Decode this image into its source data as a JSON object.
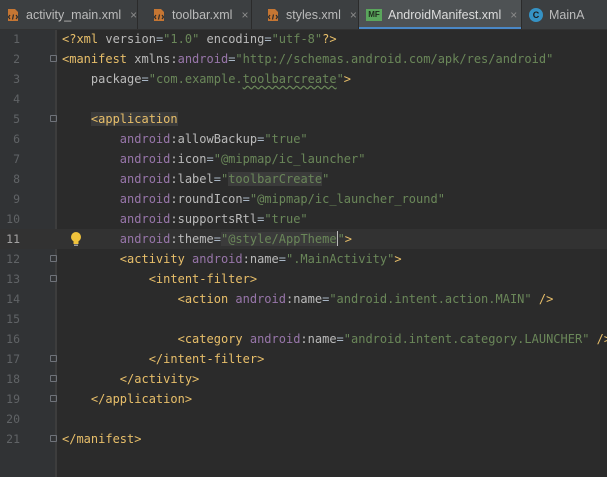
{
  "tabs": [
    {
      "label": "activity_main.xml",
      "icon": "xml-file-icon",
      "active": false
    },
    {
      "label": "toolbar.xml",
      "icon": "xml-file-icon",
      "active": false
    },
    {
      "label": "styles.xml",
      "icon": "xml-file-icon",
      "active": false
    },
    {
      "label": "AndroidManifest.xml",
      "icon": "manifest-file-icon",
      "icon_text": "MF",
      "active": true
    },
    {
      "label": "MainA",
      "icon": "class-file-icon",
      "icon_text": "C",
      "active": false
    }
  ],
  "close_glyph": "×",
  "current_line": 11,
  "colors": {
    "editor_bg": "#2b2b2b",
    "tag": "#e8bf6a",
    "attribute": "#bababa",
    "namespace": "#9876aa",
    "value": "#6a8759",
    "text": "#a9b7c6",
    "active_tab_underline": "#4a88c7"
  },
  "lines": [
    {
      "n": "1",
      "tokens": [
        [
          "pi",
          "<?xml "
        ],
        [
          "attr",
          "version"
        ],
        [
          "plain",
          "="
        ],
        [
          "val",
          "\"1.0\""
        ],
        [
          "plain",
          " "
        ],
        [
          "attr",
          "encoding"
        ],
        [
          "plain",
          "="
        ],
        [
          "val",
          "\"utf-8\""
        ],
        [
          "pi",
          "?>"
        ]
      ]
    },
    {
      "n": "2",
      "tokens": [
        [
          "tag",
          "<manifest "
        ],
        [
          "attr",
          "xmlns:"
        ],
        [
          "ns",
          "android"
        ],
        [
          "plain",
          "="
        ],
        [
          "val",
          "\"http://schemas.android.com/apk/res/android\""
        ]
      ]
    },
    {
      "n": "3",
      "tokens": [
        [
          "plain",
          "    "
        ],
        [
          "attr",
          "package"
        ],
        [
          "plain",
          "="
        ],
        [
          "val",
          "\"com.example."
        ],
        [
          "valsq",
          "toolbarcreate"
        ],
        [
          "val",
          "\""
        ],
        [
          "tag",
          ">"
        ]
      ]
    },
    {
      "n": "4",
      "tokens": []
    },
    {
      "n": "5",
      "tokens": [
        [
          "plain",
          "    "
        ],
        [
          "taghl",
          "<application"
        ]
      ]
    },
    {
      "n": "6",
      "tokens": [
        [
          "plain",
          "        "
        ],
        [
          "ns",
          "android"
        ],
        [
          "attr",
          ":allowBackup"
        ],
        [
          "plain",
          "="
        ],
        [
          "val",
          "\"true\""
        ]
      ]
    },
    {
      "n": "7",
      "tokens": [
        [
          "plain",
          "        "
        ],
        [
          "ns",
          "android"
        ],
        [
          "attr",
          ":icon"
        ],
        [
          "plain",
          "="
        ],
        [
          "val",
          "\"@mipmap/ic_launcher\""
        ]
      ]
    },
    {
      "n": "8",
      "tokens": [
        [
          "plain",
          "        "
        ],
        [
          "ns",
          "android"
        ],
        [
          "attr",
          ":label"
        ],
        [
          "plain",
          "="
        ],
        [
          "val",
          "\""
        ],
        [
          "valbox",
          "toolbarCreate"
        ],
        [
          "val",
          "\""
        ]
      ]
    },
    {
      "n": "9",
      "tokens": [
        [
          "plain",
          "        "
        ],
        [
          "ns",
          "android"
        ],
        [
          "attr",
          ":roundIcon"
        ],
        [
          "plain",
          "="
        ],
        [
          "val",
          "\"@mipmap/ic_launcher_round\""
        ]
      ]
    },
    {
      "n": "10",
      "tokens": [
        [
          "plain",
          "        "
        ],
        [
          "ns",
          "android"
        ],
        [
          "attr",
          ":supportsRtl"
        ],
        [
          "plain",
          "="
        ],
        [
          "val",
          "\"true\""
        ]
      ]
    },
    {
      "n": "11",
      "tokens": [
        [
          "plain",
          "        "
        ],
        [
          "ns",
          "android"
        ],
        [
          "attr",
          ":theme"
        ],
        [
          "plain",
          "="
        ],
        [
          "valhl",
          "\"@style/AppTheme"
        ],
        [
          "caret",
          ""
        ],
        [
          "val",
          "\""
        ],
        [
          "tag",
          ">"
        ]
      ]
    },
    {
      "n": "12",
      "tokens": [
        [
          "plain",
          "        "
        ],
        [
          "tag",
          "<activity "
        ],
        [
          "ns",
          "android"
        ],
        [
          "attr",
          ":name"
        ],
        [
          "plain",
          "="
        ],
        [
          "val",
          "\".MainActivity\""
        ],
        [
          "tag",
          ">"
        ]
      ]
    },
    {
      "n": "13",
      "tokens": [
        [
          "plain",
          "            "
        ],
        [
          "tag",
          "<intent-filter>"
        ]
      ]
    },
    {
      "n": "14",
      "tokens": [
        [
          "plain",
          "                "
        ],
        [
          "tag",
          "<action "
        ],
        [
          "ns",
          "android"
        ],
        [
          "attr",
          ":name"
        ],
        [
          "plain",
          "="
        ],
        [
          "val",
          "\"android.intent.action.MAIN\""
        ],
        [
          "tag",
          " />"
        ]
      ]
    },
    {
      "n": "15",
      "tokens": []
    },
    {
      "n": "16",
      "tokens": [
        [
          "plain",
          "                "
        ],
        [
          "tag",
          "<category "
        ],
        [
          "ns",
          "android"
        ],
        [
          "attr",
          ":name"
        ],
        [
          "plain",
          "="
        ],
        [
          "val",
          "\"android.intent.category.LAUNCHER\""
        ],
        [
          "tag",
          " />"
        ]
      ]
    },
    {
      "n": "17",
      "tokens": [
        [
          "plain",
          "            "
        ],
        [
          "tag",
          "</intent-filter>"
        ]
      ]
    },
    {
      "n": "18",
      "tokens": [
        [
          "plain",
          "        "
        ],
        [
          "tag",
          "</activity>"
        ]
      ]
    },
    {
      "n": "19",
      "tokens": [
        [
          "plain",
          "    "
        ],
        [
          "tag",
          "</application>"
        ]
      ]
    },
    {
      "n": "20",
      "tokens": []
    },
    {
      "n": "21",
      "tokens": [
        [
          "tag",
          "</manifest>"
        ]
      ]
    }
  ]
}
